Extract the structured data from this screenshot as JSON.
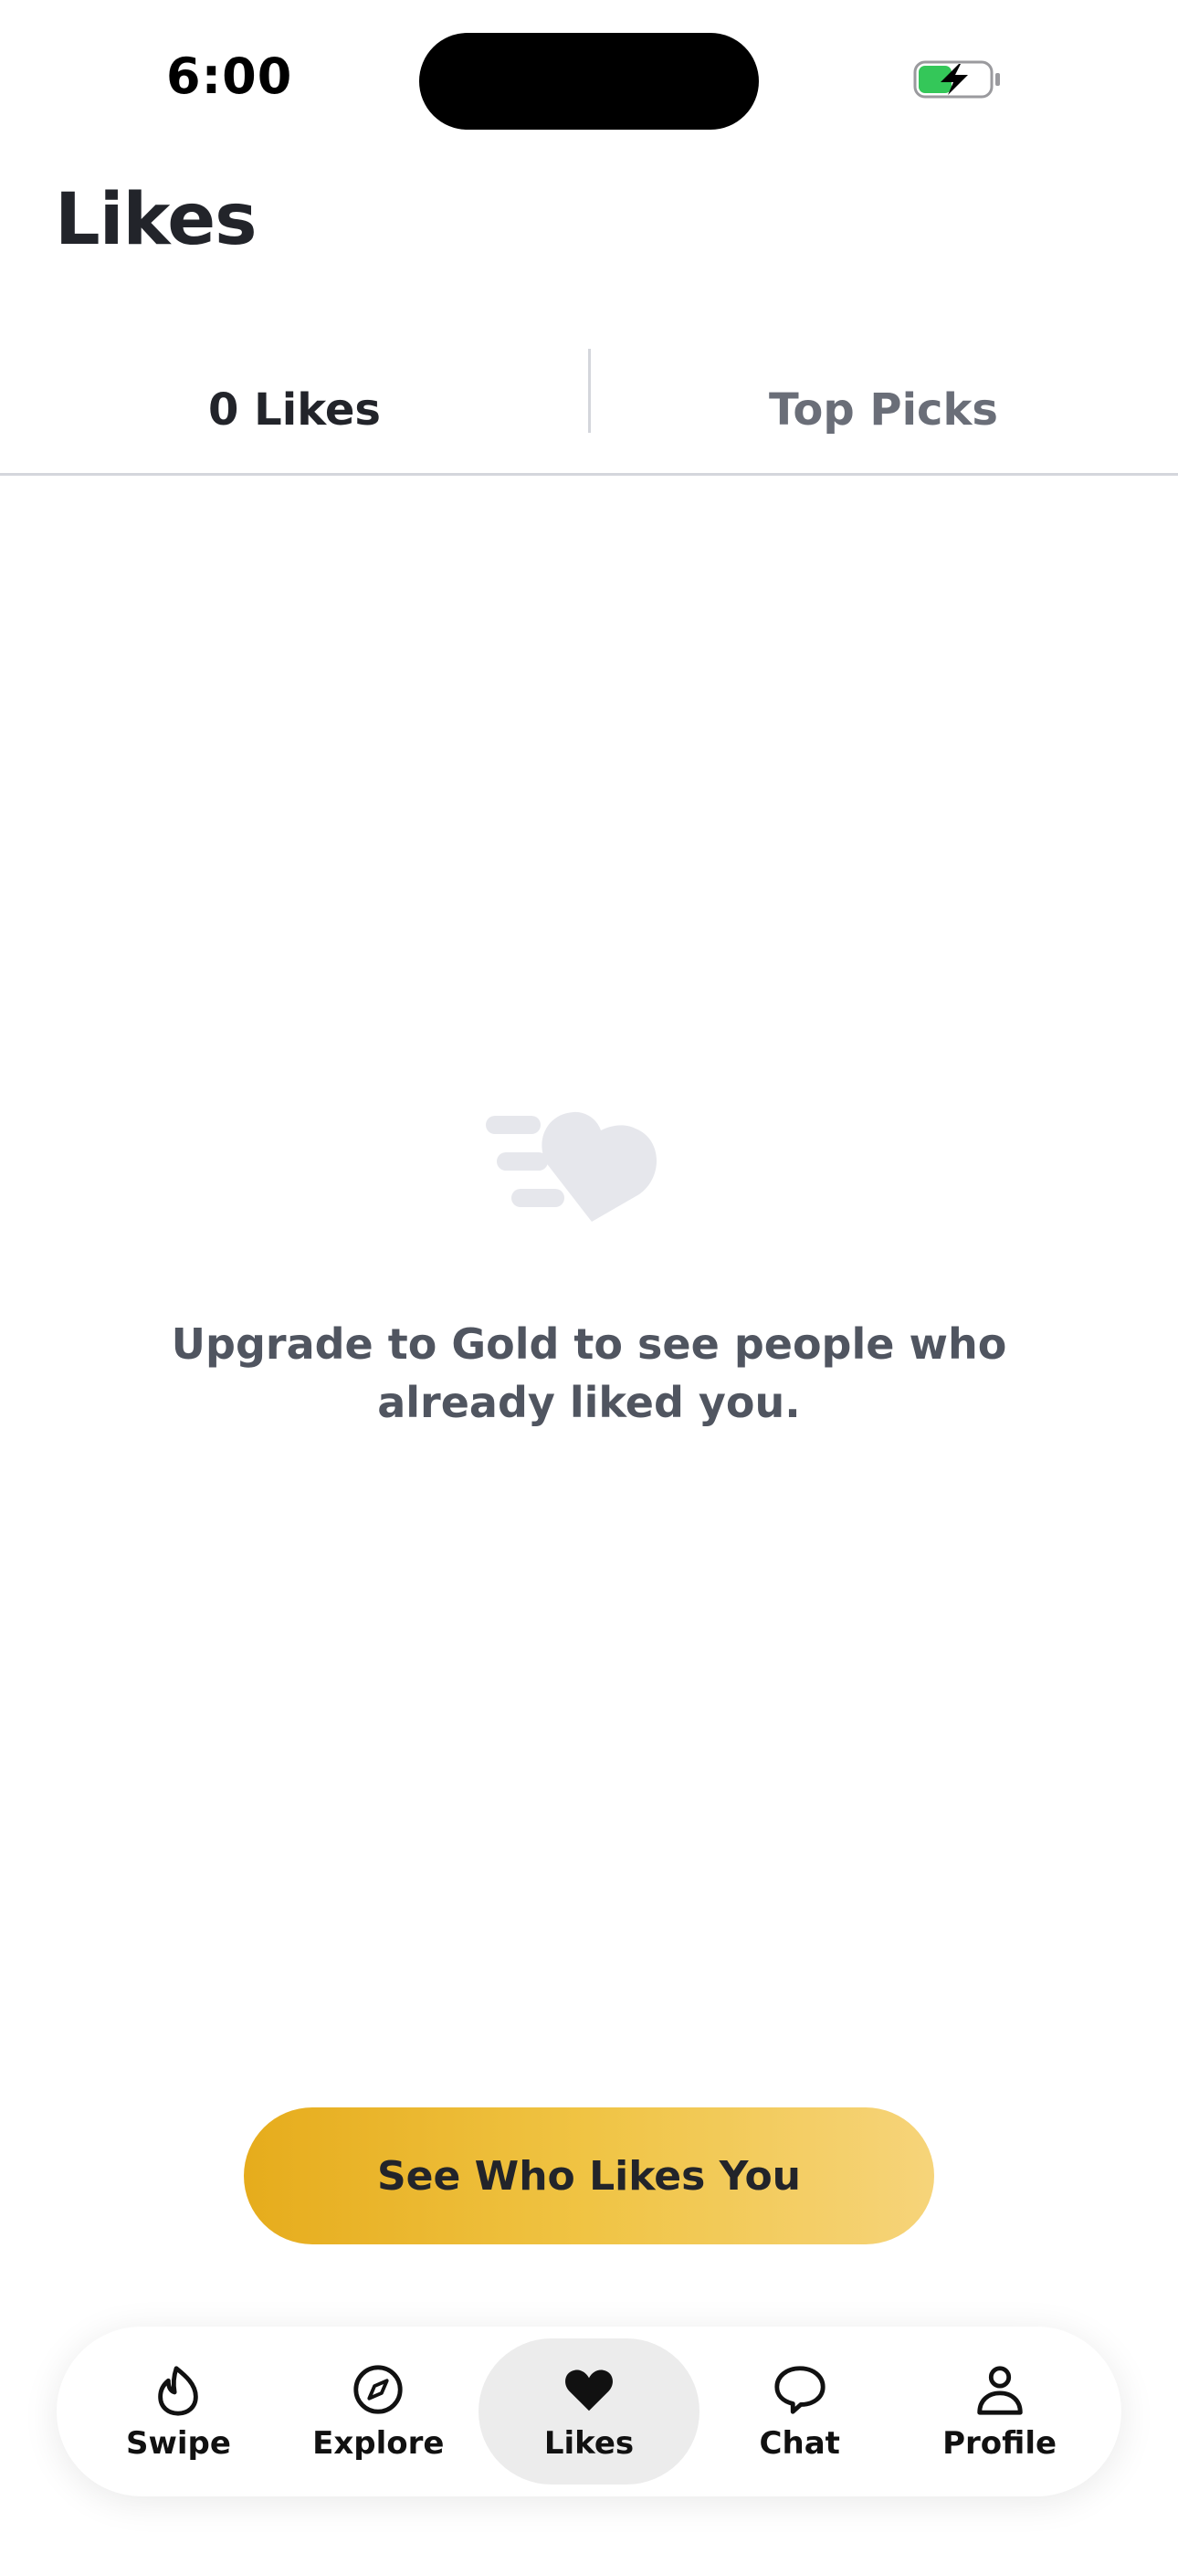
{
  "status_bar": {
    "time": "6:00",
    "battery_icon": "battery-charging-icon",
    "battery_color": "#34c759"
  },
  "header": {
    "title": "Likes"
  },
  "tabs": [
    {
      "label": "0 Likes",
      "active": true
    },
    {
      "label": "Top Picks",
      "active": false
    }
  ],
  "empty_state": {
    "icon": "flying-heart-icon",
    "message": "Upgrade to Gold to see people who already liked you."
  },
  "cta": {
    "label": "See Who Likes You",
    "gradient_start": "#e6ac1c",
    "gradient_end": "#f6d47a"
  },
  "bottom_nav": {
    "items": [
      {
        "label": "Swipe",
        "icon": "flame-icon",
        "active": false
      },
      {
        "label": "Explore",
        "icon": "compass-icon",
        "active": false
      },
      {
        "label": "Likes",
        "icon": "heart-icon",
        "active": true
      },
      {
        "label": "Chat",
        "icon": "chat-bubble-icon",
        "active": false
      },
      {
        "label": "Profile",
        "icon": "person-icon",
        "active": false
      }
    ]
  },
  "colors": {
    "text_primary": "#22242a",
    "text_secondary": "#6a6e78",
    "divider": "#d4d6dc",
    "nav_active_bg": "#ececec"
  }
}
